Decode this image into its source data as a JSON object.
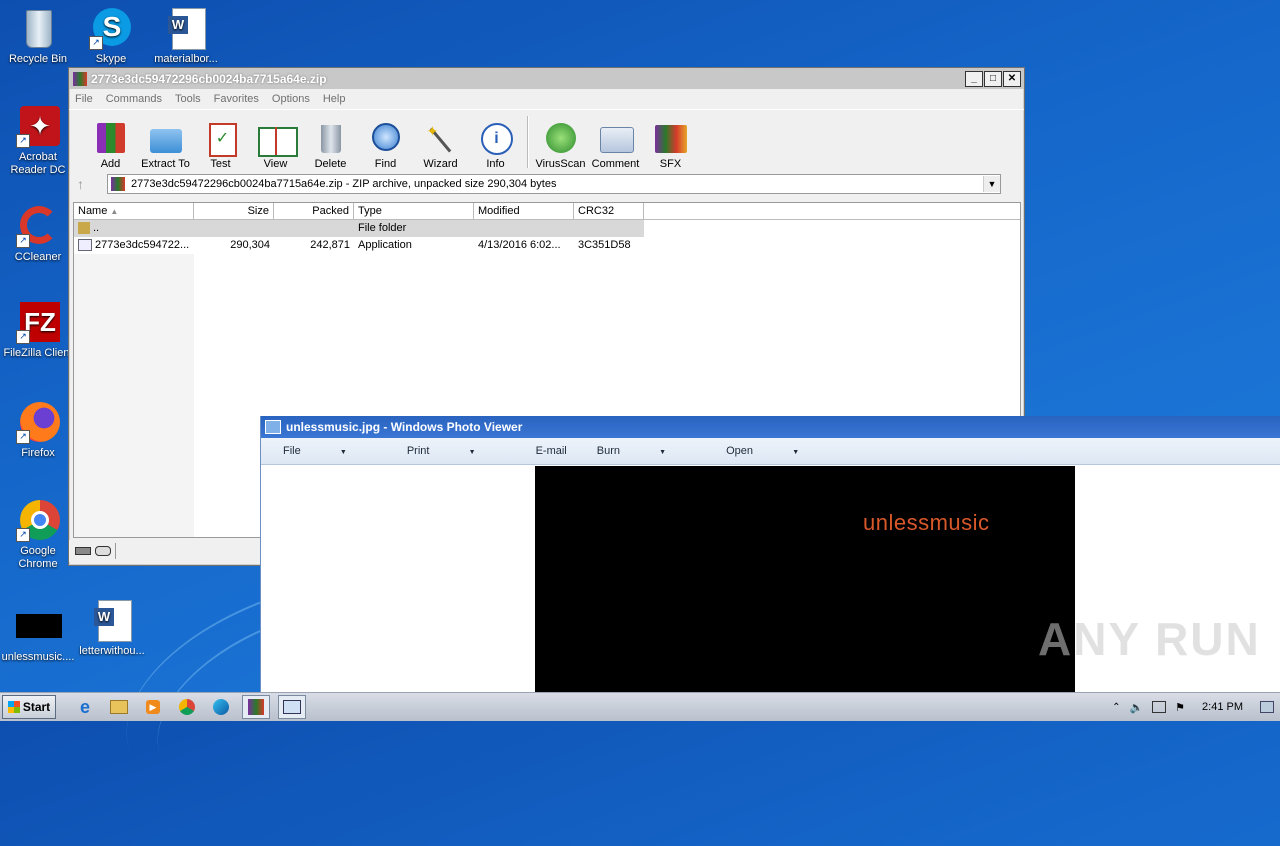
{
  "desktop": {
    "icons": [
      {
        "label": "Recycle Bin"
      },
      {
        "label": "Skype"
      },
      {
        "label": "materialbor..."
      },
      {
        "label": "Acrobat Reader DC"
      },
      {
        "label": "CCleaner"
      },
      {
        "label": "FileZilla Client"
      },
      {
        "label": "Firefox"
      },
      {
        "label": "Google Chrome"
      },
      {
        "label": "unlessmusic...."
      },
      {
        "label": "letterwithou..."
      }
    ]
  },
  "winrar": {
    "title": "2773e3dc59472296cb0024ba7715a64e.zip",
    "menu": [
      "File",
      "Commands",
      "Tools",
      "Favorites",
      "Options",
      "Help"
    ],
    "toolbar": [
      "Add",
      "Extract To",
      "Test",
      "View",
      "Delete",
      "Find",
      "Wizard",
      "Info",
      "VirusScan",
      "Comment",
      "SFX"
    ],
    "address": "2773e3dc59472296cb0024ba7715a64e.zip - ZIP archive, unpacked size 290,304 bytes",
    "columns": [
      "Name",
      "Size",
      "Packed",
      "Type",
      "Modified",
      "CRC32"
    ],
    "rows": [
      {
        "name": "..",
        "size": "",
        "packed": "",
        "type": "File folder",
        "modified": "",
        "crc": ""
      },
      {
        "name": "2773e3dc594722...",
        "size": "290,304",
        "packed": "242,871",
        "type": "Application",
        "modified": "4/13/2016 6:02...",
        "crc": "3C351D58"
      }
    ]
  },
  "photoviewer": {
    "title": "unlessmusic.jpg - Windows Photo Viewer",
    "menu": [
      "File",
      "Print",
      "E-mail",
      "Burn",
      "Open"
    ],
    "image_text": "unlessmusic"
  },
  "taskbar": {
    "start_label": "Start",
    "clock": "2:41 PM"
  },
  "watermark": "ANY RUN"
}
